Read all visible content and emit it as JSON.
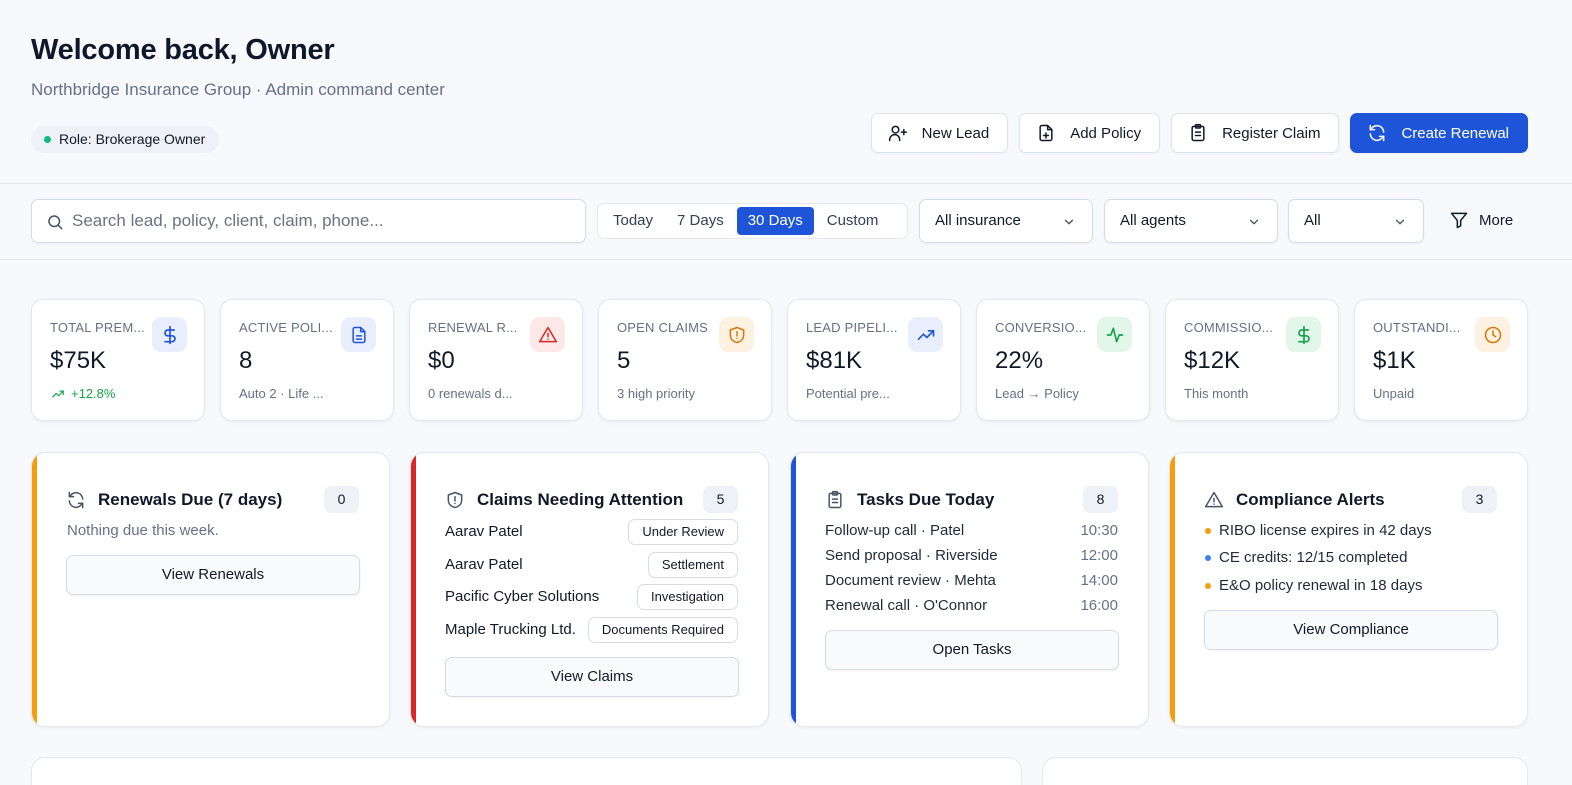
{
  "header": {
    "title": "Welcome back, Owner",
    "subtitle": "Northbridge Insurance Group · Admin command center",
    "role": "Role: Brokerage Owner"
  },
  "actions": {
    "new_lead": "New Lead",
    "add_policy": "Add Policy",
    "register_claim": "Register Claim",
    "create_renewal": "Create Renewal"
  },
  "filters": {
    "search_placeholder": "Search lead, policy, client, claim, phone...",
    "ranges": [
      "Today",
      "7 Days",
      "30 Days",
      "Custom"
    ],
    "active_range": "30 Days",
    "insurance": "All insurance",
    "agents": "All agents",
    "status": "All",
    "more": "More"
  },
  "kpis": [
    {
      "label": "TOTAL PREM...",
      "value": "$75K",
      "sub": "+12.8%",
      "icon": "dollar-icon"
    },
    {
      "label": "ACTIVE POLI...",
      "value": "8",
      "sub": "Auto 2 · Life ...",
      "icon": "document-icon"
    },
    {
      "label": "RENEWAL R...",
      "value": "$0",
      "sub": "0 renewals d...",
      "icon": "warning-icon"
    },
    {
      "label": "OPEN CLAIMS",
      "value": "5",
      "sub": "3 high priority",
      "icon": "shield-alert-icon"
    },
    {
      "label": "LEAD PIPELI...",
      "value": "$81K",
      "sub": "Potential pre...",
      "icon": "trending-up-icon"
    },
    {
      "label": "CONVERSIO...",
      "value": "22%",
      "sub": "Lead → Policy",
      "icon": "activity-icon"
    },
    {
      "label": "COMMISSIO...",
      "value": "$12K",
      "sub": "This month",
      "icon": "dollar-icon"
    },
    {
      "label": "OUTSTANDI...",
      "value": "$1K",
      "sub": "Unpaid",
      "icon": "clock-icon"
    }
  ],
  "kpi_colors": {
    "blue": "#1e55d8",
    "red": "#dc2626",
    "amber": "#d97706",
    "green": "#16a34a"
  },
  "panels": {
    "renewals": {
      "title": "Renewals Due (7 days)",
      "count": "0",
      "empty": "Nothing due this week.",
      "button": "View Renewals",
      "accent": "#f59e0b"
    },
    "claims": {
      "title": "Claims Needing Attention",
      "count": "5",
      "items": [
        {
          "name": "Aarav Patel",
          "status": "Under Review"
        },
        {
          "name": "Aarav Patel",
          "status": "Settlement"
        },
        {
          "name": "Pacific Cyber Solutions",
          "status": "Investigation"
        },
        {
          "name": "Maple Trucking Ltd.",
          "status": "Documents Required"
        }
      ],
      "button": "View Claims",
      "accent": "#dc2626"
    },
    "tasks": {
      "title": "Tasks Due Today",
      "count": "8",
      "items": [
        {
          "name": "Follow-up call · Patel",
          "time": "10:30"
        },
        {
          "name": "Send proposal · Riverside",
          "time": "12:00"
        },
        {
          "name": "Document review · Mehta",
          "time": "14:00"
        },
        {
          "name": "Renewal call · O'Connor",
          "time": "16:00"
        }
      ],
      "button": "Open Tasks",
      "accent": "#1e55d8"
    },
    "compliance": {
      "title": "Compliance Alerts",
      "count": "3",
      "items": [
        {
          "text": "RIBO license expires in 42 days",
          "color": "#f59e0b"
        },
        {
          "text": "CE credits: 12/15 completed",
          "color": "#3b82f6"
        },
        {
          "text": "E&O policy renewal in 18 days",
          "color": "#f59e0b"
        }
      ],
      "button": "View Compliance",
      "accent": "#f59e0b"
    }
  }
}
